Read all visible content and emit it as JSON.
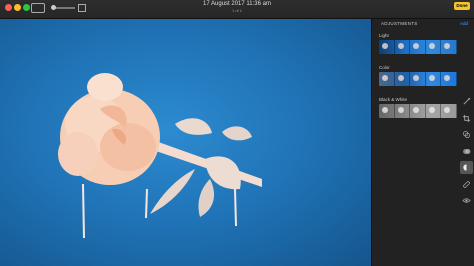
{
  "titlebar": {
    "title": "17 August 2017 11:36 am",
    "subtitle": "1 of 1",
    "done_label": "Done"
  },
  "panel": {
    "heading": "ADJUSTMENTS",
    "add_label": "Add",
    "sections": [
      {
        "label": "Light",
        "style": "light"
      },
      {
        "label": "Color",
        "style": "color"
      },
      {
        "label": "Black & White",
        "style": "bw"
      }
    ]
  },
  "tools": [
    {
      "icon": "magic-wand-icon"
    },
    {
      "icon": "crop-icon"
    },
    {
      "icon": "filters-icon"
    },
    {
      "icon": "adjust-icon",
      "active": true
    },
    {
      "icon": "bandage-retouch-icon"
    },
    {
      "icon": "red-eye-icon"
    }
  ],
  "colors": {
    "accent": "#3e98ff",
    "done_bg": "#f6c52a",
    "photo_bg": "#1f72b5"
  }
}
